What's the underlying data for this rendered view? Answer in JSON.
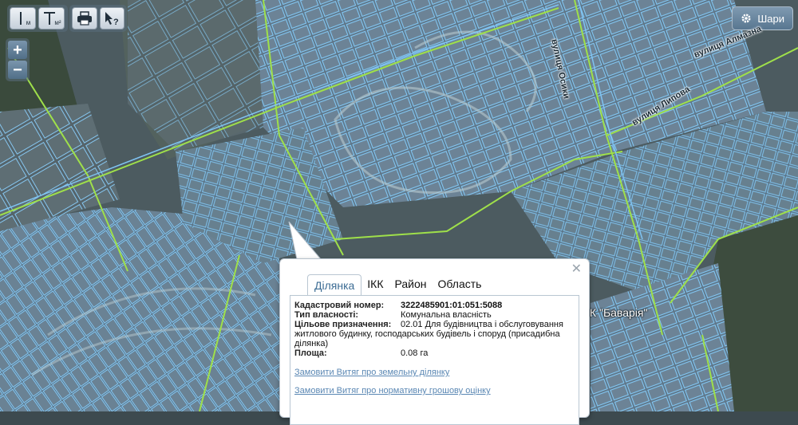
{
  "toolbar": {
    "measure_distance_label": "м",
    "measure_area_label": "м²",
    "measure_area_sup": "2"
  },
  "zoom": {
    "in_label": "+",
    "out_label": "−"
  },
  "layers_button": {
    "label": "Шари"
  },
  "map_labels": {
    "street_1": "вулиця Осики",
    "street_2": "вулиця Алмазна",
    "street_3": "вулиця Липова",
    "place": "ЖК \"Баварія\""
  },
  "popup": {
    "tabs": [
      "Ділянка",
      "ІКК",
      "Район",
      "Область"
    ],
    "active_tab": "Ділянка",
    "fields": {
      "cadastral_label": "Кадастровий номер:",
      "cadastral_value": "3222485901:01:051:5088",
      "ownership_label": "Тип власності:",
      "ownership_value": "Комунальна власність",
      "purpose_label": "Цільове призначення:",
      "purpose_value": "02.01 Для будівництва і обслуговування житлового будинку, господарських будівель і споруд (присадибна ділянка)",
      "area_label": "Площа:",
      "area_value": "0.08 га"
    },
    "links": {
      "extract_land": "Замовити Витяг про земельну ділянку",
      "extract_valuation": "Замовити Витяг про нормативну грошову оцінку"
    }
  },
  "colors": {
    "parcel_outline": "#7fc3f2",
    "road_line": "#9fe04a",
    "active_tab_text": "#3c6c94",
    "link": "#5b88b4"
  }
}
